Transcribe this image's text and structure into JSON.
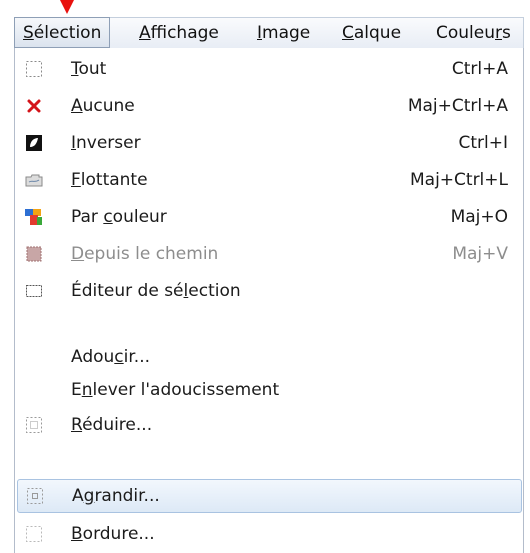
{
  "menubar": {
    "tabs": [
      {
        "label": "Sélection"
      },
      {
        "label": "Affichage"
      },
      {
        "label": "Image"
      },
      {
        "label": "Calque"
      },
      {
        "label": "Couleurs"
      }
    ]
  },
  "menu": {
    "items": [
      {
        "label": "Tout",
        "shortcut": "Ctrl+A",
        "icon": "select-all-icon",
        "enabled": true
      },
      {
        "label": "Aucune",
        "shortcut": "Maj+Ctrl+A",
        "icon": "close-icon",
        "enabled": true
      },
      {
        "label": "Inverser",
        "shortcut": "Ctrl+I",
        "icon": "invert-icon",
        "enabled": true
      },
      {
        "label": "Flottante",
        "shortcut": "Maj+Ctrl+L",
        "icon": "float-icon",
        "enabled": true
      },
      {
        "label": "Par couleur",
        "shortcut": "Maj+O",
        "icon": "by-color-icon",
        "enabled": true
      },
      {
        "label": "Depuis le chemin",
        "shortcut": "Maj+V",
        "icon": "from-path-icon",
        "enabled": false
      },
      {
        "label": "Éditeur de sélection",
        "shortcut": "",
        "icon": "selection-editor-icon",
        "enabled": true
      },
      {
        "label": "Adoucir...",
        "shortcut": "",
        "icon": "",
        "enabled": true
      },
      {
        "label": "Enlever l'adoucissement",
        "shortcut": "",
        "icon": "",
        "enabled": true
      },
      {
        "label": "Réduire...",
        "shortcut": "",
        "icon": "shrink-icon",
        "enabled": true
      },
      {
        "label": "Agrandir...",
        "shortcut": "",
        "icon": "grow-icon",
        "enabled": true
      },
      {
        "label": "Bordure...",
        "shortcut": "",
        "icon": "border-icon",
        "enabled": true
      }
    ],
    "highlighted_index": 10
  },
  "colors": {
    "annotation_arrow": "#e8110e",
    "hover_border": "#a9c3e1",
    "disabled_text": "#8d8d8d"
  }
}
